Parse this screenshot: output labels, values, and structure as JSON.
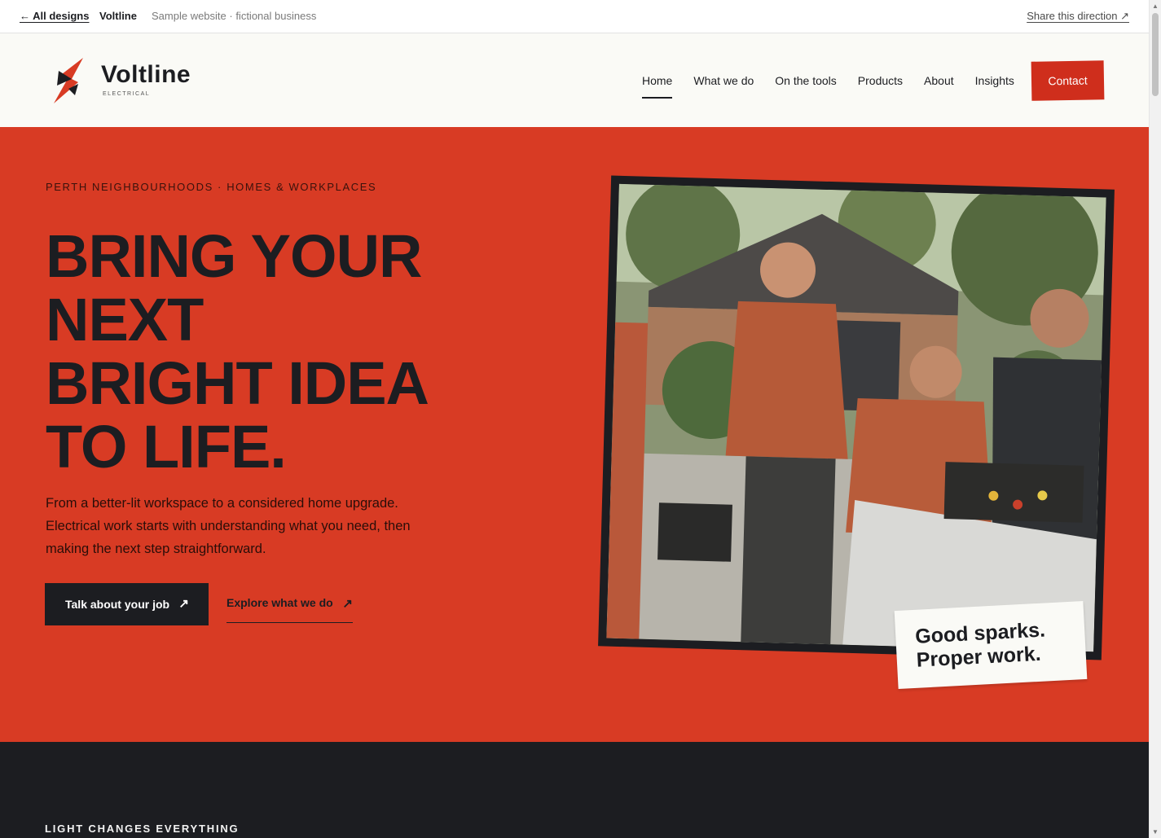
{
  "topbar": {
    "back_label": "← All designs",
    "brand": "Voltline",
    "subtitle": "Sample website · fictional business",
    "share_label": "Share this direction ↗"
  },
  "header": {
    "logo_name": "Voltline",
    "logo_tag": "ELECTRICAL",
    "nav": [
      {
        "label": "Home",
        "active": true
      },
      {
        "label": "What we do"
      },
      {
        "label": "On the tools"
      },
      {
        "label": "Products"
      },
      {
        "label": "About"
      },
      {
        "label": "Insights"
      }
    ],
    "contact_label": "Contact"
  },
  "hero": {
    "eyebrow": "PERTH NEIGHBOURHOODS · HOMES & WORKPLACES",
    "headline_lines": [
      "BRING YOUR",
      "NEXT",
      "BRIGHT IDEA",
      "TO LIFE."
    ],
    "lede": "From a better-lit workspace to a considered home upgrade. Electrical work starts with understanding what you need, then making the next step straightforward.",
    "primary_label": "Talk about your job",
    "primary_icon": "↗",
    "secondary_label": "Explore what we do",
    "secondary_icon": "↗",
    "sticker_lines": [
      "Good sparks.",
      "Proper work."
    ]
  },
  "dark_section": {
    "kicker": "LIGHT CHANGES EVERYTHING"
  },
  "colors": {
    "accent": "#d83b24",
    "accent_button": "#cf2e1c",
    "ink": "#1c1d21",
    "paper": "#fafaf6"
  }
}
